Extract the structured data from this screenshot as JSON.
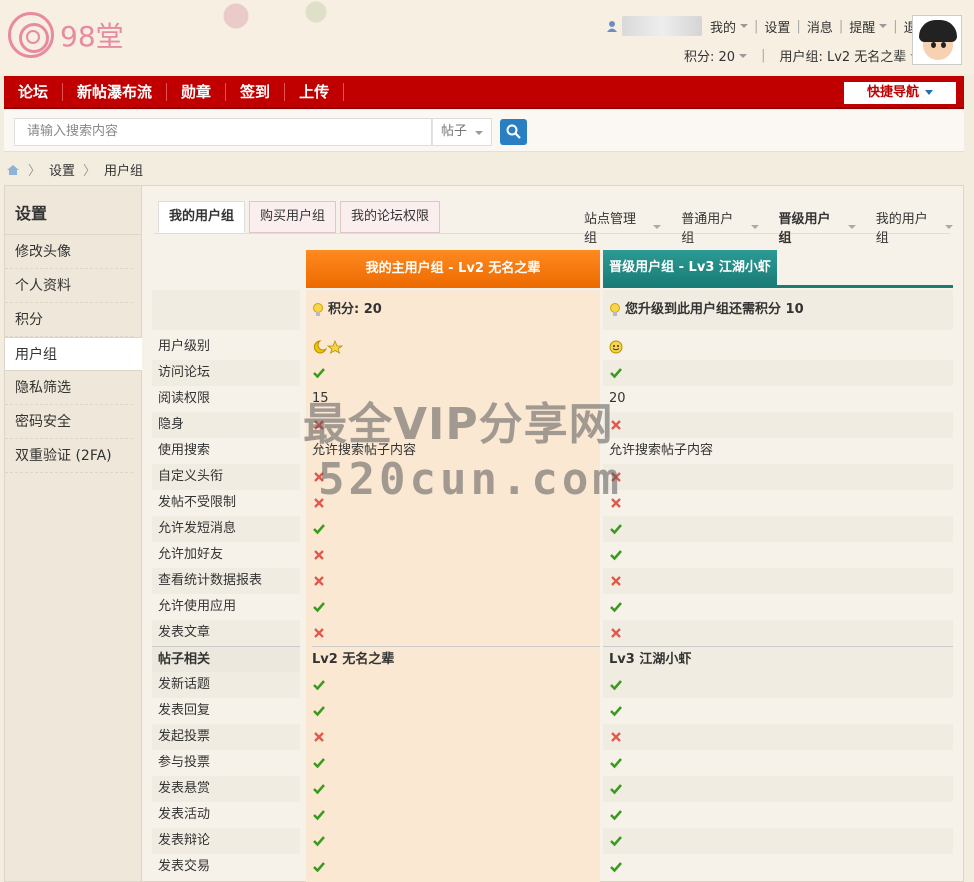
{
  "header": {
    "logo_text": "98堂",
    "user_menu": [
      "我的",
      "设置",
      "消息",
      "提醒",
      "退出"
    ],
    "points_label": "积分: 20",
    "usergroup_label": "用户组: Lv2 无名之辈"
  },
  "nav": {
    "items": [
      "论坛",
      "新帖瀑布流",
      "勋章",
      "签到",
      "上传"
    ],
    "quick_nav": "快捷导航"
  },
  "search": {
    "placeholder": "请输入搜索内容",
    "type": "帖子"
  },
  "breadcrumb": [
    "设置",
    "用户组"
  ],
  "sidebar": {
    "title": "设置",
    "items": [
      "修改头像",
      "个人资料",
      "积分",
      "用户组",
      "隐私筛选",
      "密码安全",
      "双重验证 (2FA)"
    ],
    "active_index": 3
  },
  "tabs": [
    "我的用户组",
    "购买用户组",
    "我的论坛权限"
  ],
  "right_tabs": [
    "站点管理组",
    "普通用户组",
    "晋级用户组",
    "我的用户组"
  ],
  "table": {
    "col1_header": "我的主用户组 - Lv2 无名之辈",
    "col2_header": "晋级用户组 - Lv3 江湖小虾",
    "col1_points": "积分: 20",
    "col2_points": "您升级到此用户组还需积分 10",
    "rows": [
      {
        "label": "用户级别",
        "c1": "moon-star",
        "c2": "smile"
      },
      {
        "label": "访问论坛",
        "c1": "yes",
        "c2": "yes"
      },
      {
        "label": "阅读权限",
        "c1": "15",
        "c2": "20"
      },
      {
        "label": "隐身",
        "c1": "no",
        "c2": "no"
      },
      {
        "label": "使用搜索",
        "c1": "允许搜索帖子内容",
        "c2": "允许搜索帖子内容"
      },
      {
        "label": "自定义头衔",
        "c1": "no",
        "c2": "no"
      },
      {
        "label": "发帖不受限制",
        "c1": "no",
        "c2": "no"
      },
      {
        "label": "允许发短消息",
        "c1": "yes",
        "c2": "yes"
      },
      {
        "label": "允许加好友",
        "c1": "no",
        "c2": "yes"
      },
      {
        "label": "查看统计数据报表",
        "c1": "no",
        "c2": "no"
      },
      {
        "label": "允许使用应用",
        "c1": "yes",
        "c2": "yes"
      },
      {
        "label": "发表文章",
        "c1": "no",
        "c2": "no"
      },
      {
        "label": "帖子相关",
        "c1": "Lv2 无名之辈",
        "c2": "Lv3 江湖小虾",
        "section": true
      },
      {
        "label": "发新话题",
        "c1": "yes",
        "c2": "yes"
      },
      {
        "label": "发表回复",
        "c1": "yes",
        "c2": "yes"
      },
      {
        "label": "发起投票",
        "c1": "no",
        "c2": "no"
      },
      {
        "label": "参与投票",
        "c1": "yes",
        "c2": "yes"
      },
      {
        "label": "发表悬赏",
        "c1": "yes",
        "c2": "yes"
      },
      {
        "label": "发表活动",
        "c1": "yes",
        "c2": "yes"
      },
      {
        "label": "发表辩论",
        "c1": "yes",
        "c2": "yes"
      },
      {
        "label": "发表交易",
        "c1": "yes",
        "c2": "yes"
      }
    ]
  },
  "watermark": {
    "line1": "最全VIP分享网",
    "line2": "520cun.com"
  }
}
